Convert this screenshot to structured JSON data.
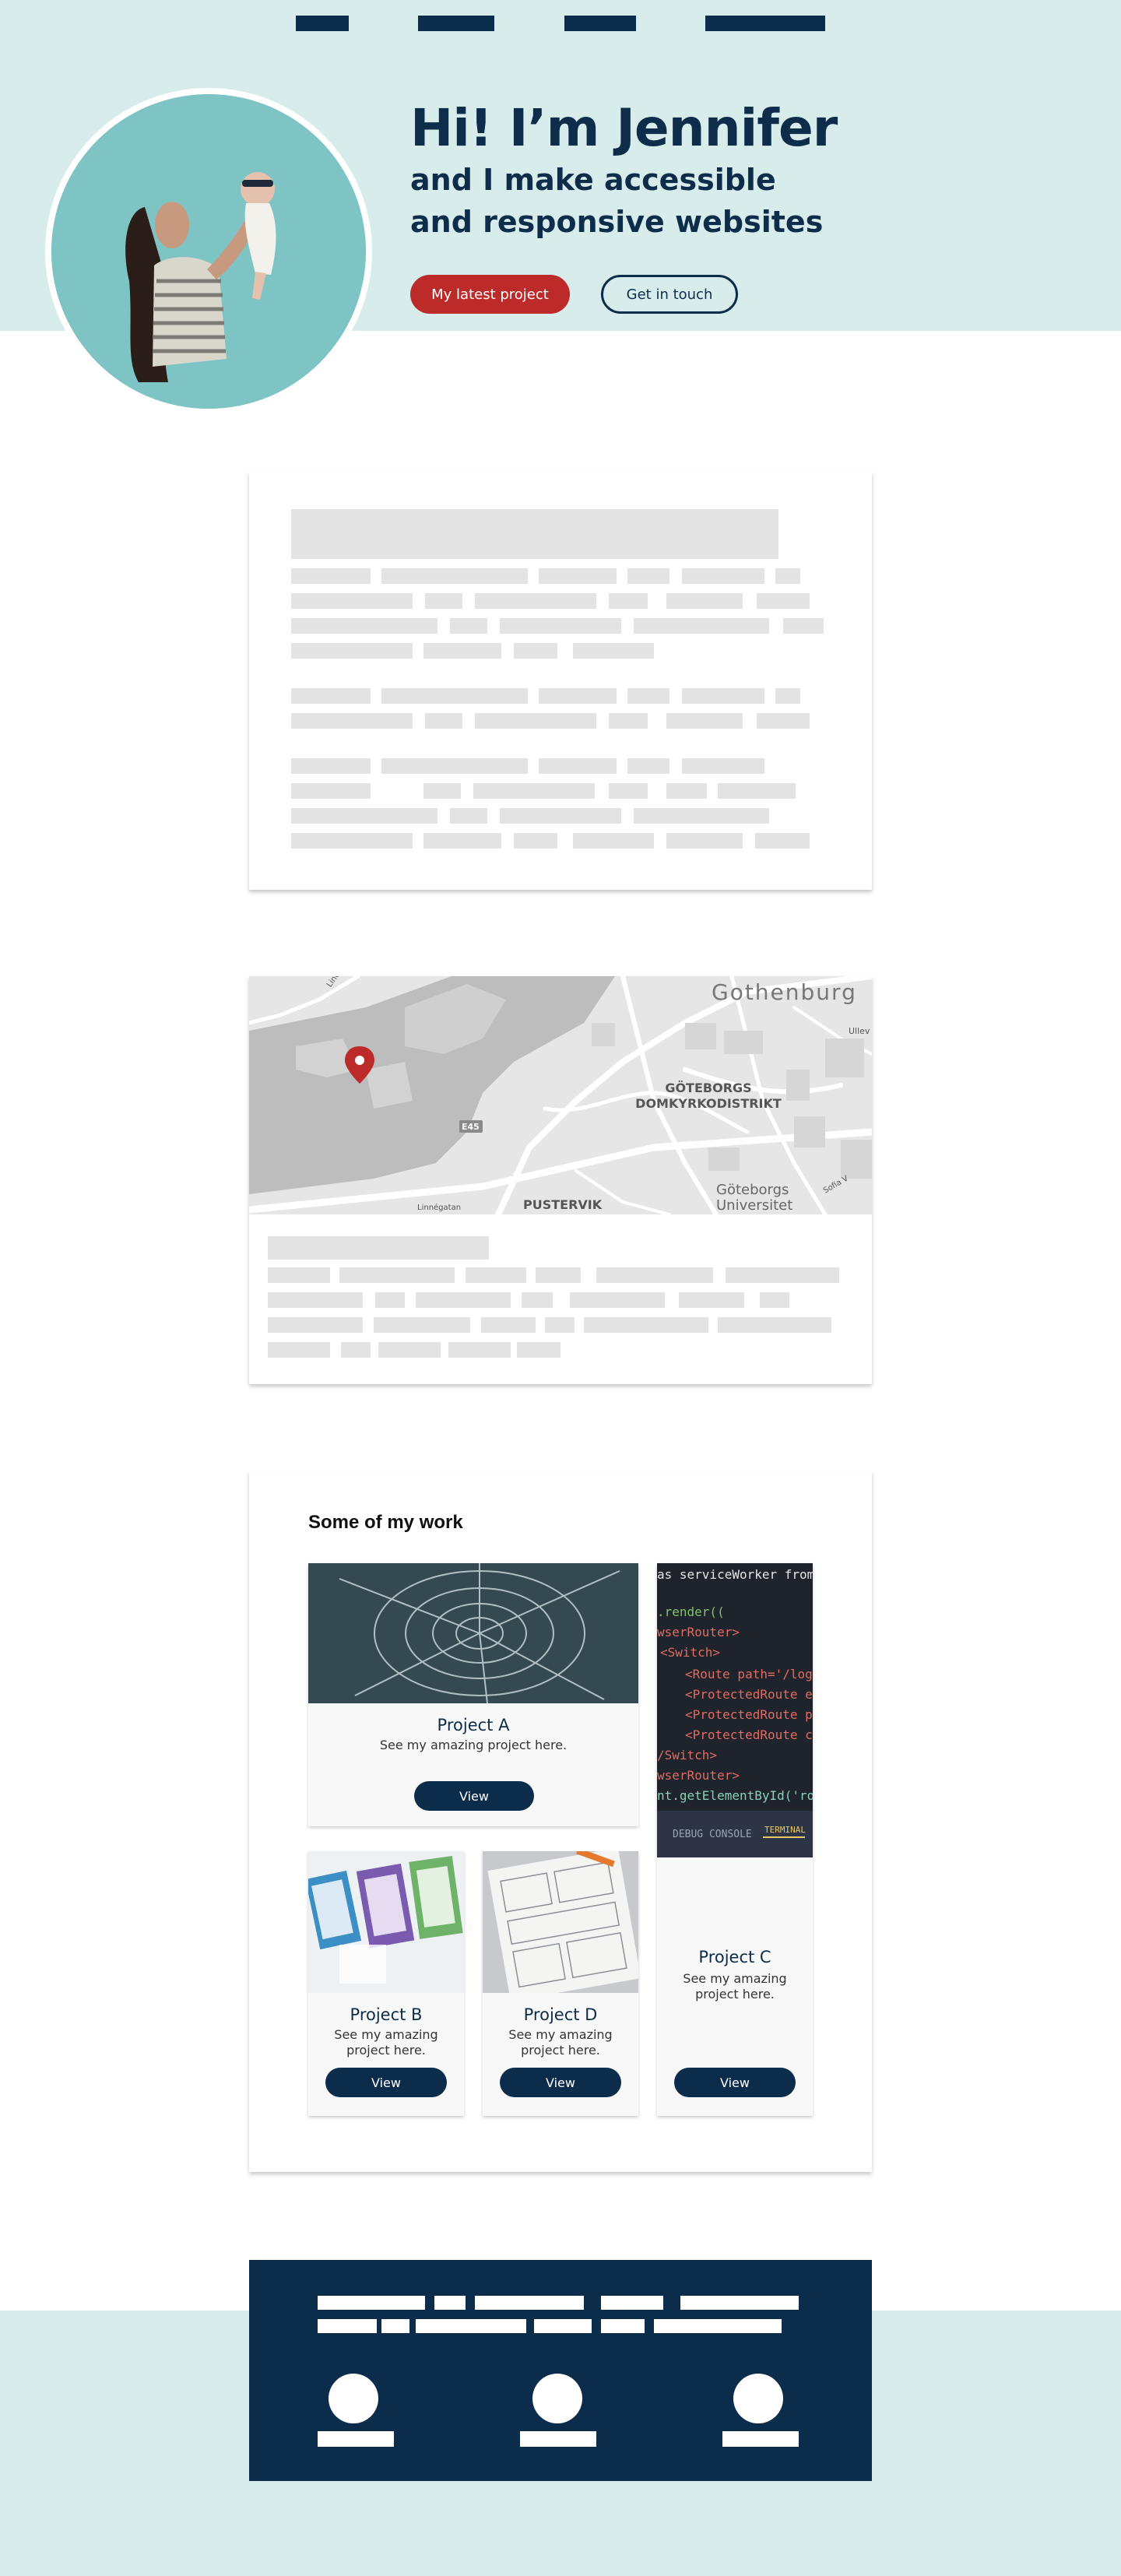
{
  "nav": {
    "items": 4
  },
  "hero": {
    "title": "Hi! I’m Jennifer",
    "subtitle": "and I make accessible and responsive websites",
    "primary_button": "My latest project",
    "secondary_button": "Get in touch"
  },
  "map": {
    "city": "Gothenburg",
    "district": "GÖTEBORGS DOMKYRKODISTRIKT",
    "district_line1": "GÖTEBORGS",
    "district_line2": "DOMKYRKODISTRIKT",
    "area": "PUSTERVIK",
    "university_line1": "Göteborgs",
    "university_line2": "Universitet",
    "road": "E45",
    "street1": "Lindholmsallén",
    "street2": "Linnégatan",
    "street3": "Ullev",
    "street4": "Sofia V",
    "marker_color": "#bd2a2a"
  },
  "work": {
    "heading": "Some of my work",
    "projects": [
      {
        "title": "Project A",
        "description": "See my amazing project here.",
        "button": "View"
      },
      {
        "title": "Project B",
        "description": "See my amazing project here.",
        "button": "View"
      },
      {
        "title": "Project D",
        "description": "See my amazing project here.",
        "button": "View"
      },
      {
        "title": "Project C",
        "description": "See my amazing project here.",
        "button": "View"
      }
    ],
    "code_lines": [
      "as serviceWorker from",
      ".render((",
      "wserRouter>",
      "<Switch>",
      "<Route path='/login",
      "<ProtectedRoute exa",
      "<ProtectedRoute pat",
      "<ProtectedRoute comp",
      "/Switch>",
      "wserRouter>",
      "nt.getElementById('root"
    ],
    "code_tabs": [
      "DEBUG CONSOLE",
      "TERMINAL"
    ]
  },
  "colors": {
    "navy": "#0c2c4b",
    "accent_red": "#bd2a2a",
    "mint": "#d8ecec",
    "placeholder": "#e3e3e3"
  }
}
